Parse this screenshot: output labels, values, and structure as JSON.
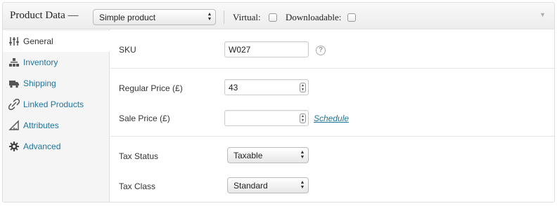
{
  "header": {
    "title": "Product Data —",
    "product_type": "Simple product",
    "virtual_label": "Virtual:",
    "downloadable_label": "Downloadable:",
    "virtual_checked": false,
    "downloadable_checked": false
  },
  "tabs": [
    {
      "label": "General",
      "icon": "sliders-icon",
      "active": true
    },
    {
      "label": "Inventory",
      "icon": "boxes-icon",
      "active": false
    },
    {
      "label": "Shipping",
      "icon": "truck-icon",
      "active": false
    },
    {
      "label": "Linked Products",
      "icon": "link-icon",
      "active": false
    },
    {
      "label": "Attributes",
      "icon": "ruler-icon",
      "active": false
    },
    {
      "label": "Advanced",
      "icon": "gear-icon",
      "active": false
    }
  ],
  "fields": {
    "sku": {
      "label": "SKU",
      "value": "W027",
      "help": "?"
    },
    "regular_price": {
      "label": "Regular Price (£)",
      "value": "43"
    },
    "sale_price": {
      "label": "Sale Price (£)",
      "value": "",
      "schedule_label": "Schedule"
    },
    "tax_status": {
      "label": "Tax Status",
      "value": "Taxable"
    },
    "tax_class": {
      "label": "Tax Class",
      "value": "Standard"
    }
  },
  "colors": {
    "link": "#21759b",
    "sidebar_bg": "#f5f5f5",
    "border": "#dfdfdf"
  }
}
